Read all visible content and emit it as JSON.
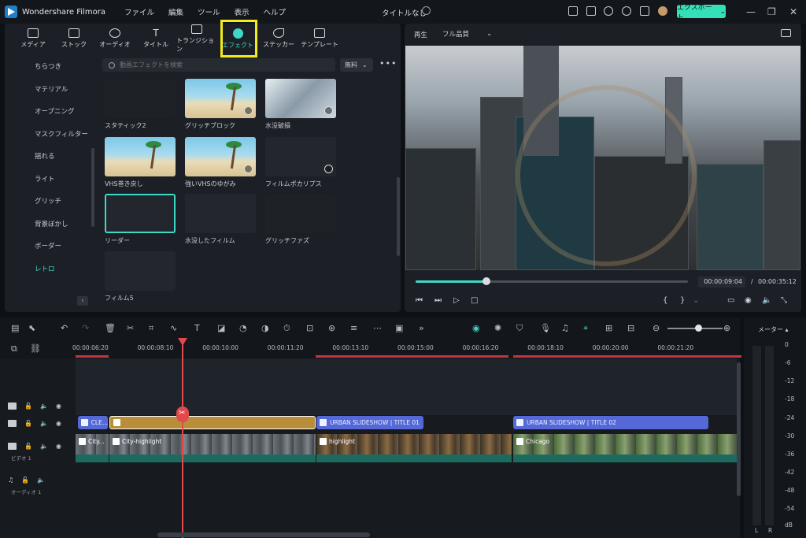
{
  "app": {
    "name": "Wondershare Filmora",
    "doc_title": "タイトルなし",
    "export_label": "エクスポート"
  },
  "menu": [
    "ファイル",
    "編集",
    "ツール",
    "表示",
    "ヘルプ"
  ],
  "tabs": [
    {
      "label": "メディア",
      "icon": "media-icon"
    },
    {
      "label": "ストック",
      "icon": "stock-icon"
    },
    {
      "label": "オーディオ",
      "icon": "audio-icon"
    },
    {
      "label": "タイトル",
      "icon": "title-icon"
    },
    {
      "label": "トランジション",
      "icon": "transition-icon"
    },
    {
      "label": "エフェクト",
      "icon": "effect-icon",
      "active": true
    },
    {
      "label": "ステッカー",
      "icon": "sticker-icon"
    },
    {
      "label": "テンプレート",
      "icon": "template-icon"
    }
  ],
  "categories": [
    "ちらつき",
    "マテリアル",
    "オープニング",
    "マスクフィルター",
    "揺れる",
    "ライト",
    "グリッチ",
    "背景ぼかし",
    "ボーダー",
    "レトロ"
  ],
  "selected_category": "レトロ",
  "search": {
    "placeholder": "動画エフェクトを検索",
    "filter": "無料"
  },
  "effects": [
    {
      "name": "スタティック2",
      "style": "dark"
    },
    {
      "name": "グリッチブロック",
      "style": "beach"
    },
    {
      "name": "水没破損",
      "style": "water"
    },
    {
      "name": "VHS巻き戻し",
      "style": "beach"
    },
    {
      "name": "強いVHSのゆがみ",
      "style": "beach"
    },
    {
      "name": "フィルムポカリプス",
      "style": "dark2"
    },
    {
      "name": "リーダー",
      "style": "dark2"
    },
    {
      "name": "水没したフィルム",
      "style": "dark2"
    },
    {
      "name": "グリッチファズ",
      "style": "dark"
    },
    {
      "name": "フィルム5",
      "style": "dark2"
    }
  ],
  "preview": {
    "play_label": "再生",
    "quality": "フル品質",
    "current_time": "00:00:09:04",
    "total_time": "00:00:35:12",
    "progress": 0.26
  },
  "ruler": [
    "00:00:06:20",
    "00:00:08:10",
    "00:00:10:00",
    "00:00:11:20",
    "00:00:13:10",
    "00:00:15:00",
    "00:00:16:20",
    "00:00:18:10",
    "00:00:20:00",
    "00:00:21:20"
  ],
  "tracks": {
    "video_label": "ビデオ 1",
    "audio_label": "オーディオ 1",
    "title_clips": [
      "CLE...",
      "URBAN SLIDESHOW | TITLE 01",
      "URBAN SLIDESHOW | TITLE 02"
    ],
    "video_clips": [
      "City...",
      "City-highlight",
      "highlight",
      "Chicago"
    ]
  },
  "meter": {
    "title": "メーター",
    "scale": [
      "0",
      "-6",
      "-12",
      "-18",
      "-24",
      "-30",
      "-36",
      "-42",
      "-48",
      "-54",
      "dB"
    ],
    "channels": [
      "L",
      "R"
    ]
  }
}
